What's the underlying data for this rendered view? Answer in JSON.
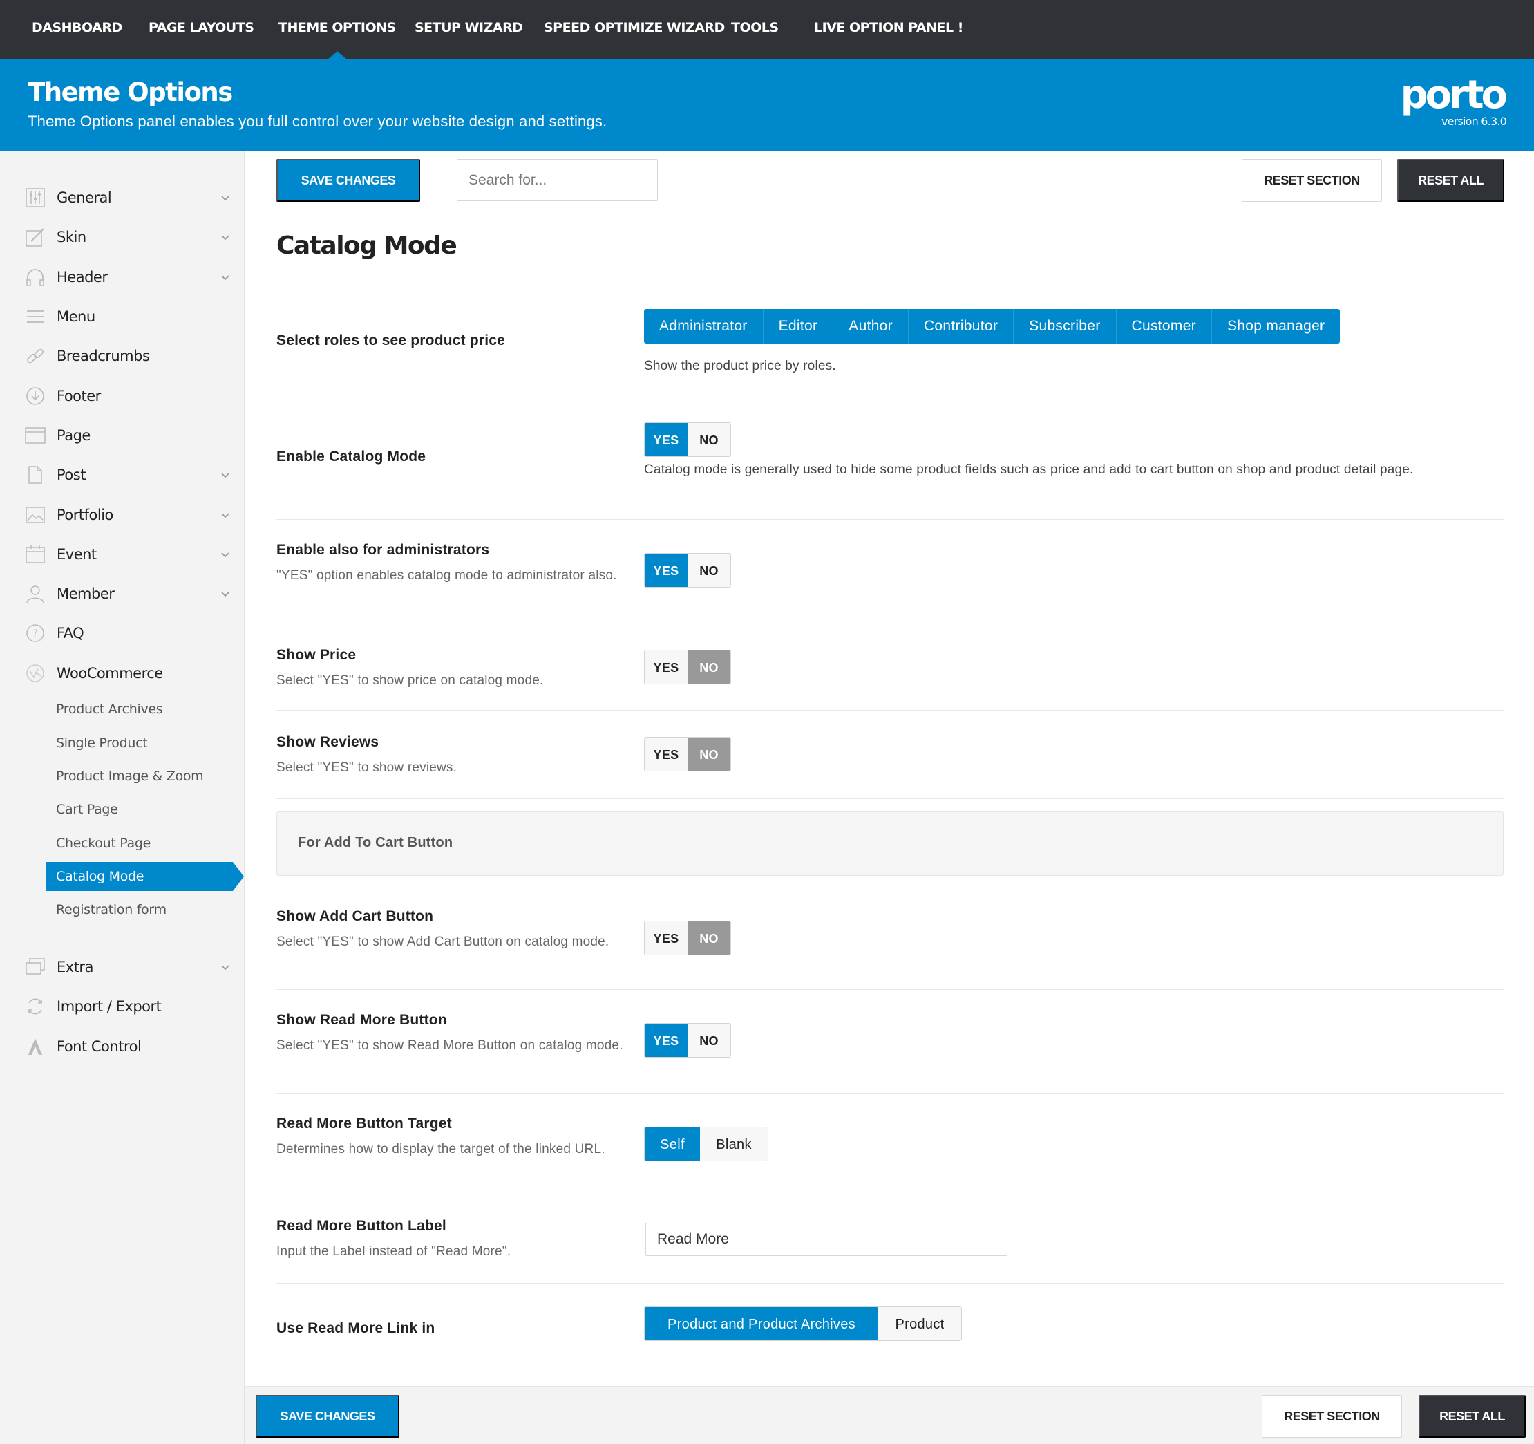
{
  "topnav": {
    "items": [
      {
        "label": "DASHBOARD"
      },
      {
        "label": "PAGE LAYOUTS"
      },
      {
        "label": "THEME OPTIONS"
      },
      {
        "label": "SETUP WIZARD"
      },
      {
        "label": "SPEED OPTIMIZE WIZARD"
      },
      {
        "label": "TOOLS"
      },
      {
        "label": "LIVE OPTION PANEL  !"
      }
    ],
    "active": "THEME OPTIONS"
  },
  "banner": {
    "title": "Theme Options",
    "subtitle": "Theme Options panel enables you full control over your website design and settings.",
    "logo": "porto",
    "version": "version 6.3.0"
  },
  "sidebar": {
    "items": [
      {
        "label": "General",
        "icon": "sliders-icon",
        "has_children": true
      },
      {
        "label": "Skin",
        "icon": "brush-icon",
        "has_children": true
      },
      {
        "label": "Header",
        "icon": "headphones-icon",
        "has_children": true
      },
      {
        "label": "Menu",
        "icon": "menu-icon",
        "has_children": false
      },
      {
        "label": "Breadcrumbs",
        "icon": "link-icon",
        "has_children": false
      },
      {
        "label": "Footer",
        "icon": "arrow-down-circle-icon",
        "has_children": false
      },
      {
        "label": "Page",
        "icon": "browser-icon",
        "has_children": false
      },
      {
        "label": "Post",
        "icon": "document-icon",
        "has_children": true
      },
      {
        "label": "Portfolio",
        "icon": "image-icon",
        "has_children": true
      },
      {
        "label": "Event",
        "icon": "calendar-icon",
        "has_children": true
      },
      {
        "label": "Member",
        "icon": "user-icon",
        "has_children": true
      },
      {
        "label": "FAQ",
        "icon": "question-circle-icon",
        "has_children": false
      },
      {
        "label": "WooCommerce",
        "icon": "woocommerce-icon",
        "has_children": false
      }
    ],
    "woo_sub_items": [
      {
        "label": "Product Archives"
      },
      {
        "label": "Single Product"
      },
      {
        "label": "Product Image & Zoom"
      },
      {
        "label": "Cart Page"
      },
      {
        "label": "Checkout Page"
      },
      {
        "label": "Catalog Mode",
        "active": true
      },
      {
        "label": "Registration form"
      }
    ],
    "bottom_items": [
      {
        "label": "Extra",
        "icon": "layers-icon",
        "has_children": true
      },
      {
        "label": "Import / Export",
        "icon": "refresh-icon",
        "has_children": false
      },
      {
        "label": "Font Control",
        "icon": "font-icon",
        "has_children": false
      }
    ]
  },
  "toolbar": {
    "save_label": "SAVE CHANGES",
    "search_placeholder": "Search for...",
    "reset_section_label": "RESET SECTION",
    "reset_all_label": "RESET ALL"
  },
  "section": {
    "title": "Catalog Mode",
    "roles_field": {
      "name": "Select roles to see product price",
      "options": [
        "Administrator",
        "Editor",
        "Author",
        "Contributor",
        "Subscriber",
        "Customer",
        "Shop manager"
      ],
      "help": "Show the product price by roles."
    },
    "enable_catalog": {
      "name": "Enable Catalog Mode",
      "value": "YES",
      "help": "Catalog mode is generally used to hide some product fields such as price and add to cart button on shop and product detail page."
    },
    "enable_admin": {
      "name": "Enable also for administrators",
      "desc": "\"YES\" option enables catalog mode to administrator also.",
      "value": "YES"
    },
    "show_price": {
      "name": "Show Price",
      "desc": "Select \"YES\" to show price on catalog mode.",
      "value": "NO"
    },
    "show_reviews": {
      "name": "Show Reviews",
      "desc": "Select \"YES\" to show reviews.",
      "value": "NO"
    },
    "group_label": "For Add To Cart Button",
    "show_add_cart": {
      "name": "Show Add Cart Button",
      "desc": "Select \"YES\" to show Add Cart Button on catalog mode.",
      "value": "NO"
    },
    "show_read_more": {
      "name": "Show Read More Button",
      "desc": "Select \"YES\" to show Read More Button on catalog mode.",
      "value": "YES"
    },
    "read_more_target": {
      "name": "Read More Button Target",
      "desc": "Determines how to display the target of the linked URL.",
      "options": [
        "Self",
        "Blank"
      ],
      "value": "Self"
    },
    "read_more_label": {
      "name": "Read More Button Label",
      "desc": "Input the Label instead of \"Read More\".",
      "value": "Read More"
    },
    "read_more_link": {
      "name": "Use Read More Link in",
      "options": [
        "Product and Product Archives",
        "Product"
      ],
      "value": "Product and Product Archives"
    }
  },
  "toggle_labels": {
    "yes": "YES",
    "no": "NO"
  },
  "colors": {
    "accent": "#0088cc",
    "dark": "#2f3338",
    "off": "#999999"
  }
}
